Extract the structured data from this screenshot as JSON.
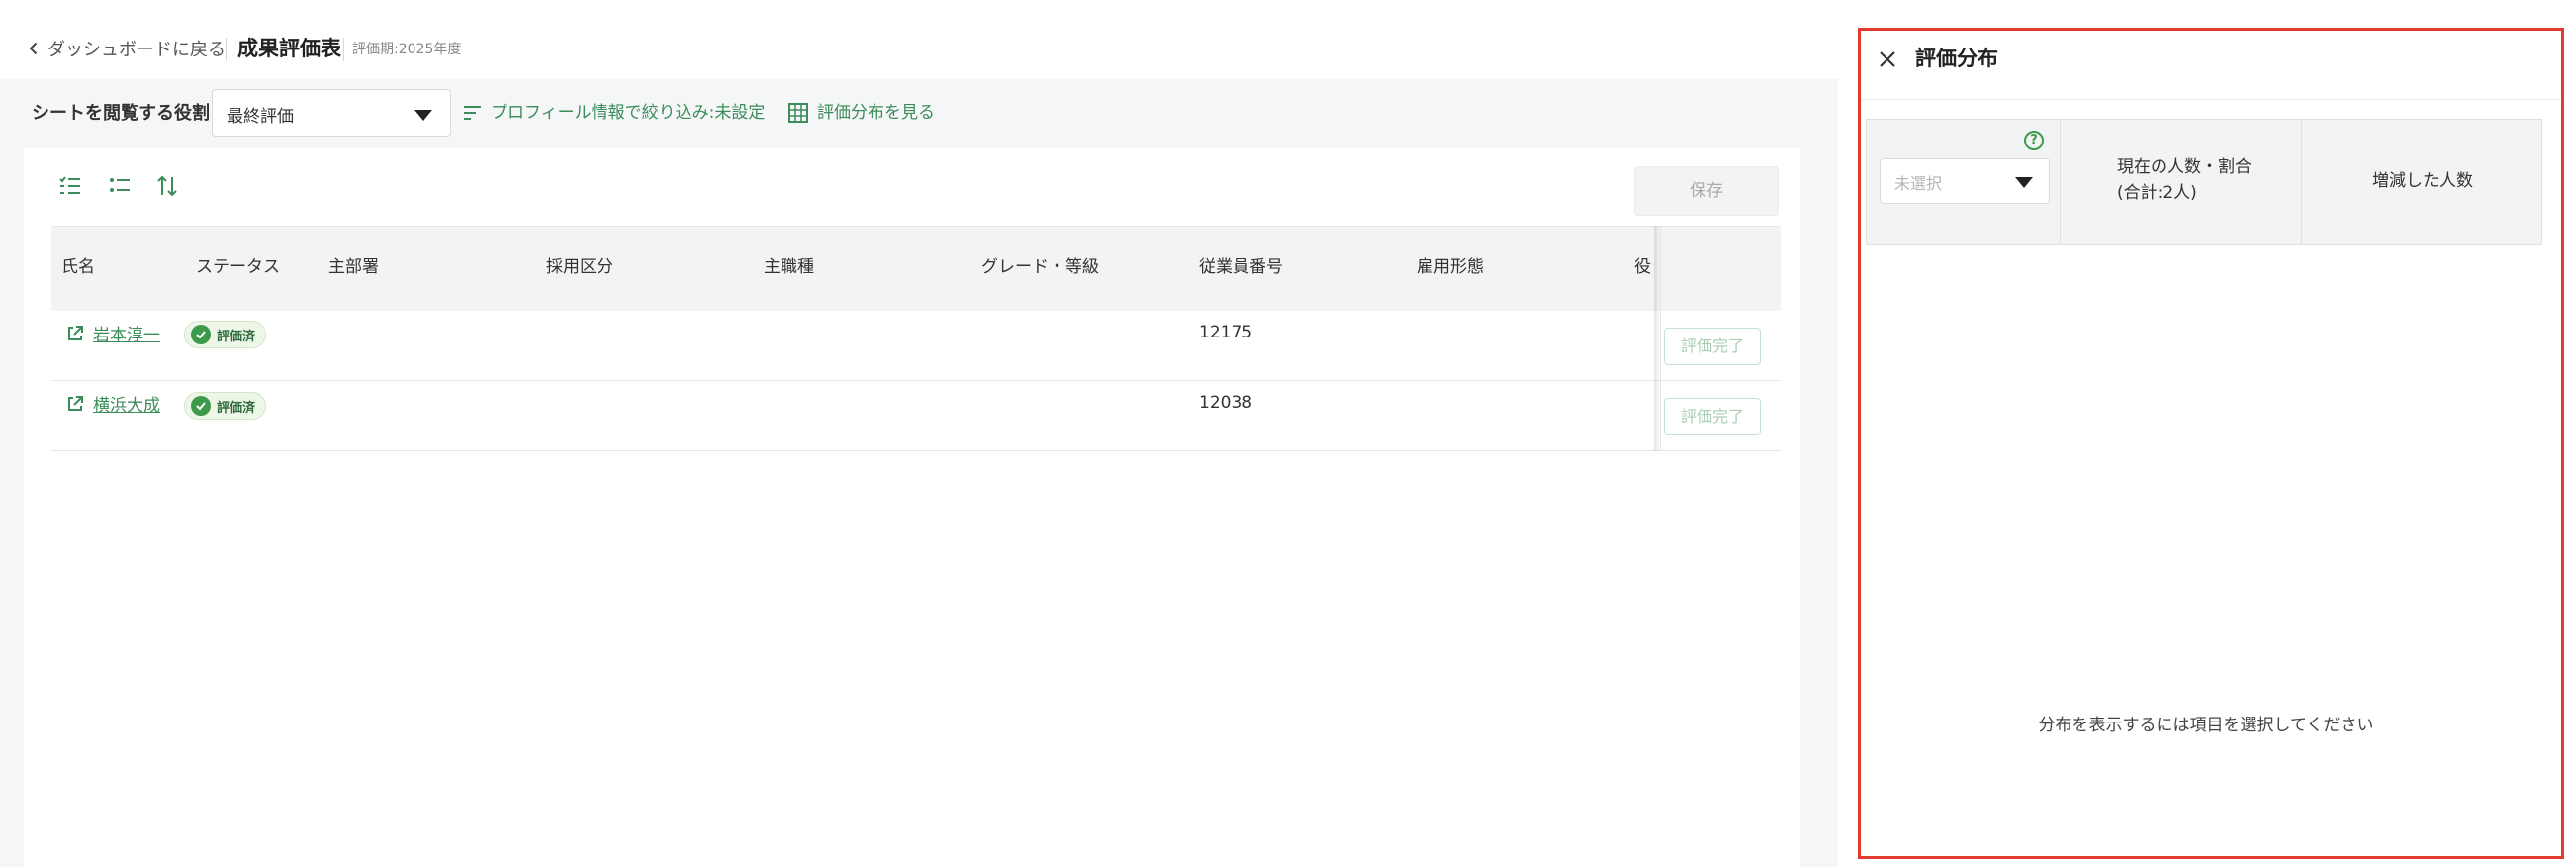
{
  "header": {
    "back_label": "ダッシュボードに戻る",
    "title": "成果評価表",
    "period": "評価期:2025年度"
  },
  "filter": {
    "role_label": "シートを閲覧する役割",
    "role_value": "最終評価",
    "profile_filter_label": "プロフィール情報で絞り込み:未設定",
    "distribution_link_label": "評価分布を見る"
  },
  "toolbar": {
    "icons": [
      "checklist-icon",
      "list-icon",
      "sort-icon"
    ],
    "save_label": "保存"
  },
  "table": {
    "columns": [
      "氏名",
      "ステータス",
      "主部署",
      "採用区分",
      "主職種",
      "グレード・等級",
      "従業員番号",
      "雇用形態",
      "役"
    ],
    "rows": [
      {
        "name": "岩本淳一",
        "status": "評価済",
        "employee_no": "12175",
        "action": "評価完了"
      },
      {
        "name": "横浜大成",
        "status": "評価済",
        "employee_no": "12038",
        "action": "評価完了"
      }
    ]
  },
  "panel": {
    "title": "評価分布",
    "select_placeholder": "未選択",
    "col_current_line1": "現在の人数・割合",
    "col_current_line2": "(合計:2人)",
    "col_change": "増減した人数",
    "empty_message": "分布を表示するには項目を選択してください"
  },
  "colors": {
    "accent_green": "#3c8c5a",
    "highlight_border": "#e23b2e"
  }
}
